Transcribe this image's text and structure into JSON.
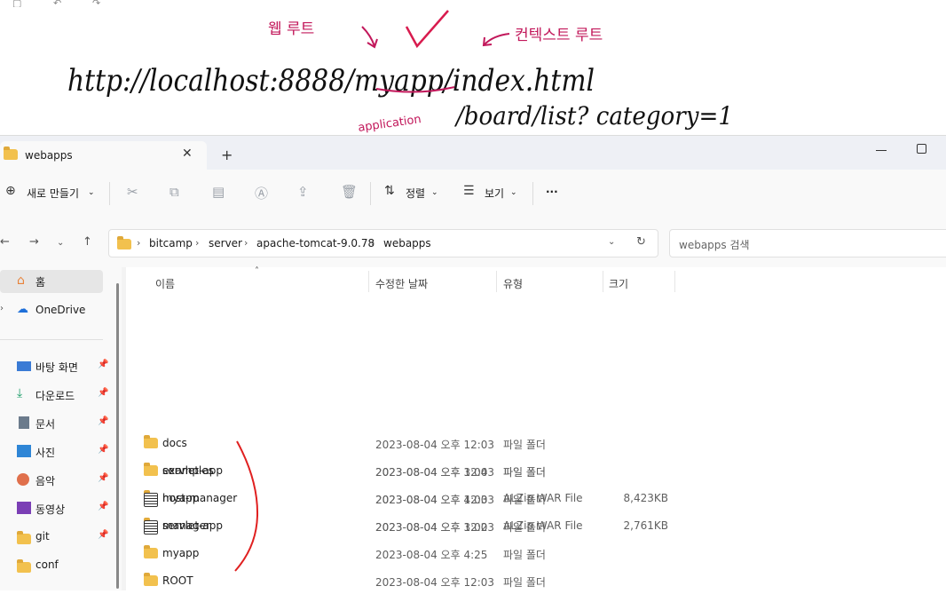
{
  "notes": {
    "url_text": "http://localhost:8888/myapp/index.html",
    "second_line": "/board/list? category=1",
    "label_web_root": "웹 루트",
    "label_context_root": "컨텍스트 루트",
    "label_application": "application"
  },
  "window": {
    "tab_title": "webapps",
    "tab_close": "✕",
    "new_tab": "+"
  },
  "toolbar": {
    "new_label": "새로 만들기",
    "sort_label": "정렬",
    "view_label": "보기",
    "more_label": "···"
  },
  "address": {
    "breadcrumbs": [
      "bitcamp",
      "server",
      "apache-tomcat-9.0.78",
      "webapps"
    ],
    "search_placeholder": "webapps 검색"
  },
  "sidebar": {
    "items": [
      {
        "label": "홈",
        "icon": "home-icon"
      },
      {
        "label": "OneDrive",
        "icon": "cloud-icon"
      },
      {
        "label": "바탕 화면",
        "icon": "desktop-icon"
      },
      {
        "label": "다운로드",
        "icon": "download-icon"
      },
      {
        "label": "문서",
        "icon": "document-icon"
      },
      {
        "label": "사진",
        "icon": "pictures-icon"
      },
      {
        "label": "음악",
        "icon": "music-icon"
      },
      {
        "label": "동영상",
        "icon": "video-icon"
      },
      {
        "label": "git",
        "icon": "folder-icon"
      },
      {
        "label": "conf",
        "icon": "folder-icon"
      }
    ]
  },
  "columns": {
    "name": "이름",
    "modified": "수정한 날짜",
    "type": "유형",
    "size": "크기"
  },
  "files": [
    {
      "name": "docs",
      "modified": "2023-08-04 오후 12:03",
      "type": "파일 폴더",
      "size": "",
      "icon": "folder-icon"
    },
    {
      "name": "examples",
      "modified": "2023-08-04 오후 12:03",
      "type": "파일 폴더",
      "size": "",
      "icon": "folder-icon"
    },
    {
      "name": "host-manager",
      "modified": "2023-08-04 오후 12:03",
      "type": "파일 폴더",
      "size": "",
      "icon": "folder-icon"
    },
    {
      "name": "manager",
      "modified": "2023-08-04 오후 12:03",
      "type": "파일 폴더",
      "size": "",
      "icon": "folder-icon"
    },
    {
      "name": "myapp",
      "modified": "2023-08-04 오후 4:25",
      "type": "파일 폴더",
      "size": "",
      "icon": "folder-icon"
    },
    {
      "name": "ROOT",
      "modified": "2023-08-04 오후 12:03",
      "type": "파일 폴더",
      "size": "",
      "icon": "folder-icon"
    },
    {
      "name": "servlet-app",
      "modified": "2023-08-04 오후 3:04",
      "type": "파일 폴더",
      "size": "",
      "icon": "folder-icon"
    },
    {
      "name": "myapp",
      "modified": "2023-08-04 오후 4:03",
      "type": "ALZip WAR File",
      "size": "8,423KB",
      "icon": "war-file-icon"
    },
    {
      "name": "servlet-app",
      "modified": "2023-08-04 오후 3:02",
      "type": "ALZip WAR File",
      "size": "2,761KB",
      "icon": "war-file-icon"
    }
  ]
}
